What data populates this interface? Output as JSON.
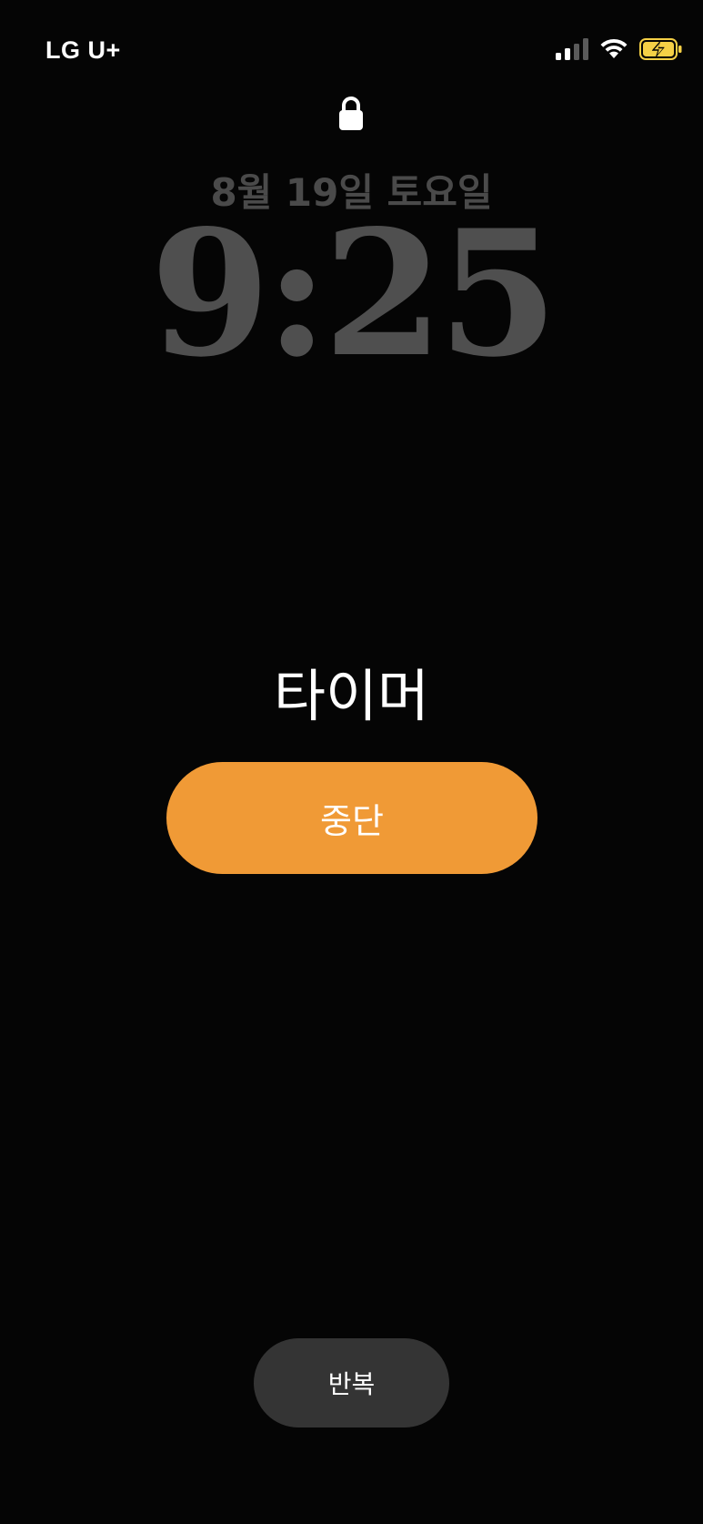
{
  "status_bar": {
    "carrier": "LG U+",
    "icons": [
      "cellular-signal-icon",
      "wifi-icon",
      "battery-charging-icon"
    ],
    "battery_color": "#f5d046"
  },
  "lock_screen": {
    "lock_icon": "lock-icon",
    "date": "8월 19일 토요일",
    "time": "9:25"
  },
  "alarm": {
    "title": "타이머",
    "stop_label": "중단",
    "repeat_label": "반복",
    "accent_color": "#f09a36"
  }
}
